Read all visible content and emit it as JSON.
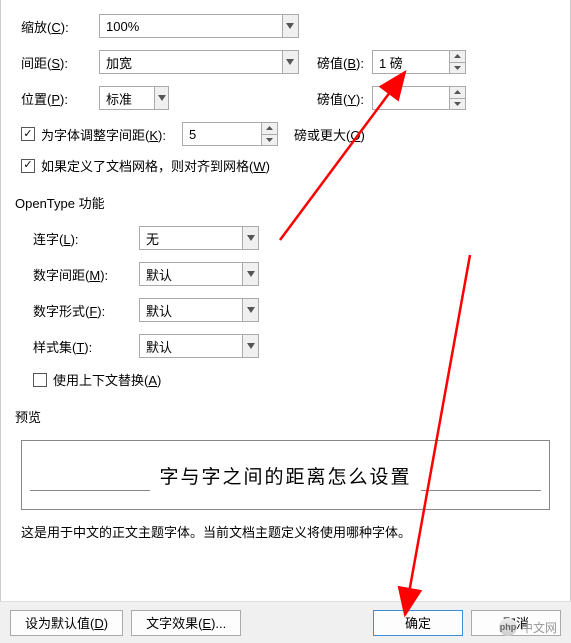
{
  "scale": {
    "label_pre": "缩放(",
    "hotkey": "C",
    "label_post": "):",
    "value": "100%"
  },
  "spacing": {
    "label_pre": "间距(",
    "hotkey": "S",
    "label_post": "):",
    "value": "加宽"
  },
  "spacing_amount": {
    "label_pre": "磅值(",
    "hotkey": "B",
    "label_post": "):",
    "value": "1 磅"
  },
  "position": {
    "label_pre": "位置(",
    "hotkey": "P",
    "label_post": "):",
    "value": "标准"
  },
  "position_amount": {
    "label_pre": "磅值(",
    "hotkey": "Y",
    "label_post": "):",
    "value": ""
  },
  "kerning": {
    "checked": true,
    "label_pre": "为字体调整字间距(",
    "hotkey": "K",
    "label_post": "):",
    "value": "5",
    "unit_pre": "磅或更大(",
    "unit_hotkey": "O",
    "unit_post": ")"
  },
  "snap": {
    "checked": true,
    "label_pre": "如果定义了文档网格，则对齐到网格(",
    "hotkey": "W",
    "label_post": ")"
  },
  "opentype": {
    "title": "OpenType 功能",
    "ligature": {
      "label_pre": "连字(",
      "hotkey": "L",
      "label_post": "):",
      "value": "无"
    },
    "numspace": {
      "label_pre": "数字间距(",
      "hotkey": "M",
      "label_post": "):",
      "value": "默认"
    },
    "numform": {
      "label_pre": "数字形式(",
      "hotkey": "F",
      "label_post": "):",
      "value": "默认"
    },
    "styleset": {
      "label_pre": "样式集(",
      "hotkey": "T",
      "label_post": "):",
      "value": "默认"
    },
    "context": {
      "checked": false,
      "label_pre": "使用上下文替换(",
      "hotkey": "A",
      "label_post": ")"
    }
  },
  "preview": {
    "title": "预览",
    "text": "字与字之间的距离怎么设置"
  },
  "description": "这是用于中文的正文主题字体。当前文档主题定义将使用哪种字体。",
  "buttons": {
    "default": {
      "pre": "设为默认值(",
      "hotkey": "D",
      "post": ")"
    },
    "effects": {
      "pre": "文字效果(",
      "hotkey": "E",
      "post": ")..."
    },
    "ok": "确定",
    "cancel": "取消"
  },
  "watermark": "中文网",
  "arrow_color": "#ff0000"
}
